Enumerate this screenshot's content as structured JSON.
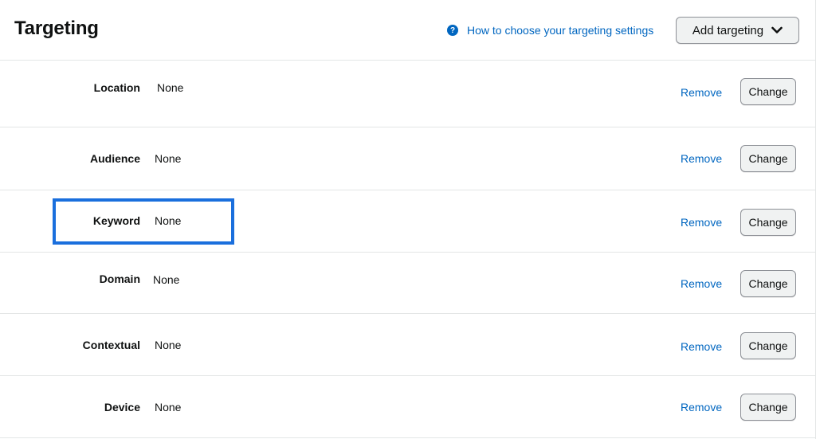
{
  "header": {
    "title": "Targeting",
    "help_link": "How to choose your targeting settings",
    "help_icon": "question-circle-icon",
    "add_button": "Add targeting"
  },
  "rows": [
    {
      "label": "Location",
      "value": "None",
      "remove": "Remove",
      "change": "Change"
    },
    {
      "label": "Audience",
      "value": "None",
      "remove": "Remove",
      "change": "Change"
    },
    {
      "label": "Keyword",
      "value": "None",
      "remove": "Remove",
      "change": "Change"
    },
    {
      "label": "Domain",
      "value": "None",
      "remove": "Remove",
      "change": "Change"
    },
    {
      "label": "Contextual",
      "value": "None",
      "remove": "Remove",
      "change": "Change"
    },
    {
      "label": "Device",
      "value": "None",
      "remove": "Remove",
      "change": "Change"
    }
  ],
  "colors": {
    "link": "#0066c0",
    "highlight": "#1a6fdd",
    "button_bg": "#f0f2f2",
    "divider": "#e3e6e6"
  }
}
